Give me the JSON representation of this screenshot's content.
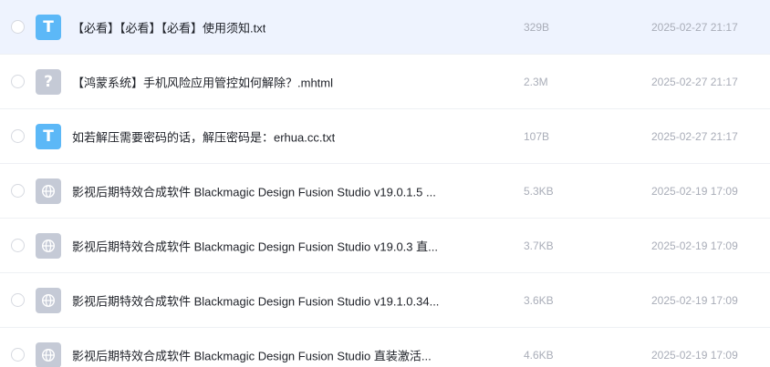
{
  "colors": {
    "selected_row_bg": "#eef3fe",
    "txt_icon": "#5cb8f7",
    "generic_icon": "#c5cad6",
    "meta_text": "#a9adb8"
  },
  "files": [
    {
      "icon": "txt-icon",
      "icon_glyph": "T",
      "name": "【必看】【必看】【必看】使用须知.txt",
      "size": "329B",
      "date": "2025-02-27 21:17"
    },
    {
      "icon": "question-icon",
      "icon_glyph": "?",
      "name": "【鸿蒙系统】手机风险应用管控如何解除？.mhtml",
      "size": "2.3M",
      "date": "2025-02-27 21:17"
    },
    {
      "icon": "txt-icon",
      "icon_glyph": "T",
      "name": "如若解压需要密码的话，解压密码是：erhua.cc.txt",
      "size": "107B",
      "date": "2025-02-27 21:17"
    },
    {
      "icon": "globe-icon",
      "icon_glyph": "",
      "name": "影视后期特效合成软件 Blackmagic Design Fusion Studio v19.0.1.5 ...",
      "size": "5.3KB",
      "date": "2025-02-19 17:09"
    },
    {
      "icon": "globe-icon",
      "icon_glyph": "",
      "name": "影视后期特效合成软件 Blackmagic Design Fusion Studio v19.0.3 直...",
      "size": "3.7KB",
      "date": "2025-02-19 17:09"
    },
    {
      "icon": "globe-icon",
      "icon_glyph": "",
      "name": "影视后期特效合成软件 Blackmagic Design Fusion Studio v19.1.0.34...",
      "size": "3.6KB",
      "date": "2025-02-19 17:09"
    },
    {
      "icon": "globe-icon",
      "icon_glyph": "",
      "name": "影视后期特效合成软件 Blackmagic Design Fusion Studio 直装激活...",
      "size": "4.6KB",
      "date": "2025-02-19 17:09"
    }
  ]
}
